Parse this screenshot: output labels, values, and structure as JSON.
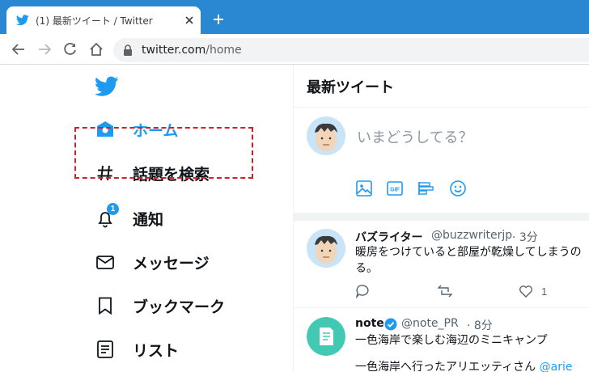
{
  "browser": {
    "tab_title": "(1) 最新ツイート / Twitter",
    "url_host": "twitter.com",
    "url_path": "/home"
  },
  "nav": {
    "items": [
      {
        "label": "ホーム",
        "icon": "home-icon",
        "active": true
      },
      {
        "label": "話題を検索",
        "icon": "hashtag-icon"
      },
      {
        "label": "通知",
        "icon": "bell-icon",
        "badge": "1"
      },
      {
        "label": "メッセージ",
        "icon": "envelope-icon"
      },
      {
        "label": "ブックマーク",
        "icon": "bookmark-icon"
      },
      {
        "label": "リスト",
        "icon": "list-icon"
      }
    ]
  },
  "main": {
    "title": "最新ツイート",
    "compose_placeholder": "いまどうしてる？"
  },
  "tweets": [
    {
      "name": "バズライター",
      "handle": "@buzzwriterjp",
      "time": "· 3分",
      "line1": "暖房をつけていると部屋が乾燥してしまうの",
      "line2": "る。",
      "like_count": "1"
    },
    {
      "name": "note",
      "handle": "@note_PR",
      "time": "· 8分",
      "line1": "一色海岸で楽しむ海辺のミニキャンプ",
      "line2": "一色海岸へ行ったアリエッティさん",
      "mention": "@arie"
    }
  ],
  "colors": {
    "brand": "#1d9bf0",
    "chrome_tabbar": "#2a87d1",
    "highlight": "#d0202a"
  }
}
